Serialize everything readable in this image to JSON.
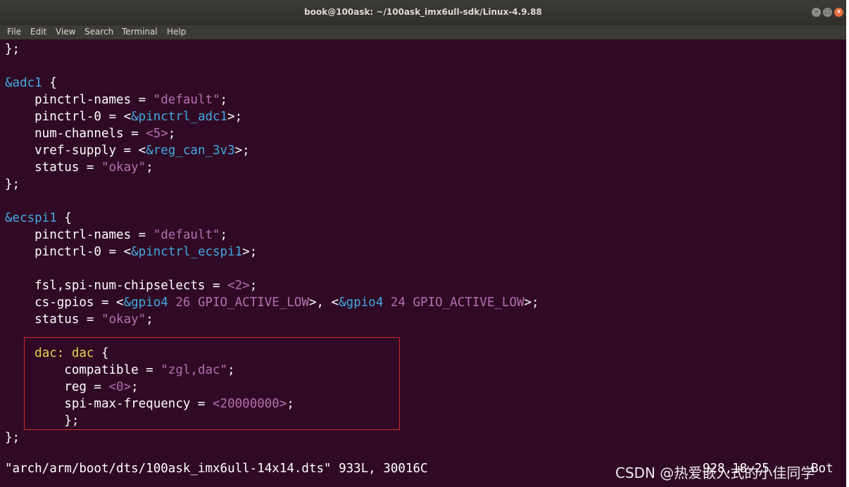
{
  "window": {
    "title": "book@100ask: ~/100ask_imx6ull-sdk/Linux-4.9.88",
    "background": "#300a24"
  },
  "menu": [
    "File",
    "Edit",
    "View",
    "Search",
    "Terminal",
    "Help"
  ],
  "lines": {
    "l1": "};",
    "l3_name": "&adc1",
    "l3_brace": " {",
    "l4_key": "    pinctrl-names = ",
    "l4_val": "\"default\"",
    "l4_end": ";",
    "l5_key": "    pinctrl-0 = <",
    "l5_ref": "&pinctrl_adc1",
    "l5_end": ">;",
    "l6_key": "    num-channels = ",
    "l6_val": "<5>",
    "l6_end": ";",
    "l7_key": "    vref-supply = <",
    "l7_ref": "&reg_can_3v3",
    "l7_end": ">;",
    "l8_key": "    status = ",
    "l8_val": "\"okay\"",
    "l8_end": ";",
    "l9": "};",
    "l11_name": "&ecspi1",
    "l11_brace": " {",
    "l12_key": "    pinctrl-names = ",
    "l12_val": "\"default\"",
    "l12_end": ";",
    "l13_key": "    pinctrl-0 = <",
    "l13_ref": "&pinctrl_ecspi1",
    "l13_end": ">;",
    "l15_key": "    fsl,spi-num-chipselects = ",
    "l15_val": "<2>",
    "l15_end": ";",
    "l16_key": "    cs-gpios = <",
    "l16_ref1": "&gpio4",
    "l16_v1": " 26 GPIO_ACTIVE_LOW",
    "l16_mid": ">, <",
    "l16_ref2": "&gpio4",
    "l16_v2": " 24 GPIO_ACTIVE_LOW",
    "l16_end": ">;",
    "l17_key": "    status = ",
    "l17_val": "\"okay\"",
    "l17_end": ";",
    "l19_ind": "    ",
    "l19_lbl": "dac:",
    "l19_node": " dac",
    "l19_brace": " {",
    "l20_key": "        compatible = ",
    "l20_val": "\"zgl,dac\"",
    "l20_end": ";",
    "l21_key": "        reg = ",
    "l21_val": "<0>",
    "l21_end": ";",
    "l22_key": "        spi-max-frequency = ",
    "l22_val": "<20000000>",
    "l22_end": ";",
    "l23": "        };",
    "l24": "};"
  },
  "status": {
    "file_info": "\"arch/arm/boot/dts/100ask_imx6ull-14x14.dts\" 933L, 30016C",
    "position": "928,18-25",
    "scroll": "Bot"
  },
  "watermark": "CSDN @热爱嵌入式的小佳同学",
  "colors": {
    "node_ref": "#41a8e1",
    "string": "#b46eb1",
    "label": "#e8d44d",
    "highlight_box": "#d02a2a"
  }
}
